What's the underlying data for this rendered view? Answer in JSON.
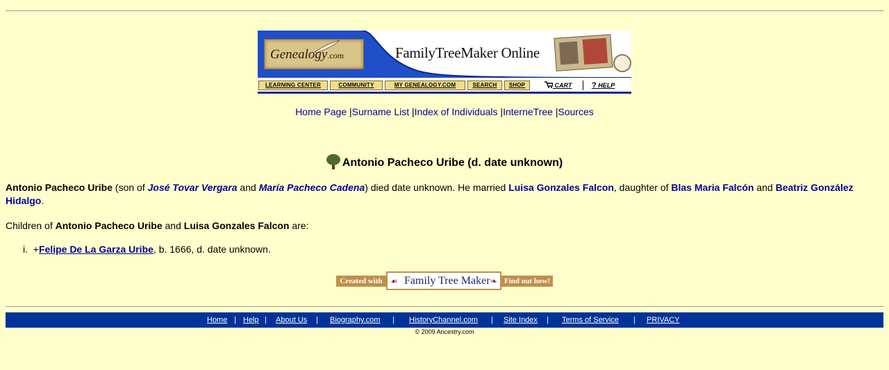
{
  "banner": {
    "logo_text": "Genealogy",
    "logo_suffix": ".com",
    "title": "FamilyTreeMaker Online",
    "nav": [
      "LEARNING CENTER",
      "COMMUNITY",
      "MY GENEALOGY.COM",
      "SEARCH",
      "SHOP"
    ],
    "cart_label": "CART",
    "help_label": "HELP"
  },
  "site_nav": [
    "Home Page",
    "Surname List",
    "Index of Individuals",
    "InterneTree",
    "Sources"
  ],
  "page": {
    "title": "Antonio Pacheco Uribe (d. date unknown)",
    "subject": "Antonio Pacheco Uribe",
    "son_of": " (son of ",
    "father": "José Tovar Vergara",
    "and1": " and ",
    "mother": "María Pacheco Cadena",
    "died_text": ") died date unknown. He married ",
    "spouse": "Luisa Gonzales Falcon",
    "daughter_of": ", daughter of ",
    "spouse_father": "Blas Maria Falcón",
    "and2": " and ",
    "spouse_mother": "Beatriz González Hidalgo",
    "period": ".",
    "children_intro_prefix": "Children of ",
    "children_intro_and": " and ",
    "children_intro_suffix": " are:",
    "children": [
      {
        "index": "i.",
        "prefix": "+",
        "name": "Felipe De La Garza Uribe",
        "details": ", b. 1666, d. date unknown."
      }
    ]
  },
  "badge": {
    "left": "Created with",
    "center": "Family Tree Maker",
    "right": "Find out how!"
  },
  "footer": {
    "links": [
      "Home",
      "Help",
      "About Us",
      "Biography.com",
      "HistoryChannel.com",
      "Site Index",
      "Terms of Service",
      "PRIVACY"
    ],
    "copyright": "© 2009 Ancestry.com"
  },
  "colors": {
    "background": "#ffffcc",
    "link": "#000099",
    "footer_bar": "#003399",
    "banner_blue": "#1f4fc9"
  }
}
